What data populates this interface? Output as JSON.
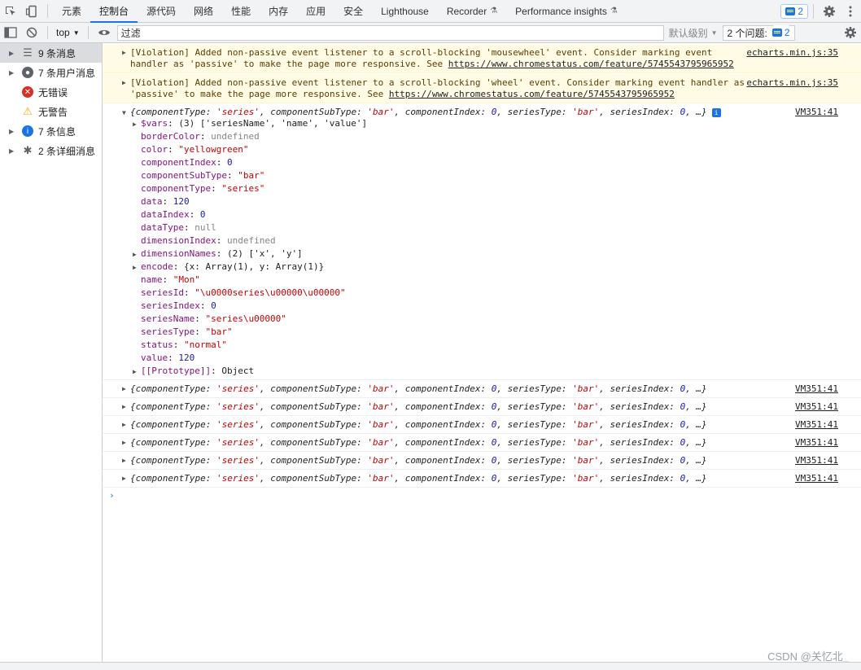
{
  "tabs": [
    {
      "label": "元素"
    },
    {
      "label": "控制台",
      "active": true
    },
    {
      "label": "源代码"
    },
    {
      "label": "网络"
    },
    {
      "label": "性能"
    },
    {
      "label": "内存"
    },
    {
      "label": "应用"
    },
    {
      "label": "安全"
    },
    {
      "label": "Lighthouse"
    },
    {
      "label": "Recorder"
    },
    {
      "label": "Performance insights"
    }
  ],
  "issue_badge_count": "2",
  "toolbar": {
    "context": "top",
    "filter_placeholder": "过滤",
    "levels_label": "默认级别",
    "issues_label": "2 个问题:",
    "issues_count": "2"
  },
  "sidebar": [
    {
      "label": "9 条消息",
      "icon": "list-icon",
      "selected": true
    },
    {
      "label": "7 条用户消息",
      "icon": "user-icon"
    },
    {
      "label": "无错误",
      "icon": "error-icon"
    },
    {
      "label": "无警告",
      "icon": "warning-icon"
    },
    {
      "label": "7 条信息",
      "icon": "info-icon"
    },
    {
      "label": "2 条详细消息",
      "icon": "bug-icon"
    }
  ],
  "warnings": [
    {
      "text_pre": "[Violation] Added non-passive event listener to a scroll-blocking 'mousewheel' event. Consider marking event\nhandler as 'passive' to make the page more responsive. See ",
      "link": "https://www.chromestatus.com/feature/5745543795965952",
      "src": "echarts.min.js:35"
    },
    {
      "text_pre": "[Violation] Added non-passive event listener to a scroll-blocking 'wheel' event. Consider marking event handler as\n'passive' to make the page more responsive. See ",
      "link": "https://www.chromestatus.com/feature/5745543795965952",
      "src": "echarts.min.js:35"
    }
  ],
  "log_src": "VM351:41",
  "summary": {
    "p1": "{componentType: ",
    "v1": "'series'",
    "p2": ", componentSubType: ",
    "v2": "'bar'",
    "p3": ", componentIndex: ",
    "v3": "0",
    "p4": ", seriesType: ",
    "v4": "'bar'",
    "p5": ", seriesIndex: ",
    "v5": "0",
    "p6": ", …}"
  },
  "expanded_props": [
    {
      "key": "$vars",
      "val": "(3) ['seriesName', 'name', 'value']",
      "type": "arr",
      "collapsible": true
    },
    {
      "key": "borderColor",
      "val": "undefined",
      "type": "u"
    },
    {
      "key": "color",
      "val": "\"yellowgreen\"",
      "type": "s"
    },
    {
      "key": "componentIndex",
      "val": "0",
      "type": "n"
    },
    {
      "key": "componentSubType",
      "val": "\"bar\"",
      "type": "s"
    },
    {
      "key": "componentType",
      "val": "\"series\"",
      "type": "s"
    },
    {
      "key": "data",
      "val": "120",
      "type": "n"
    },
    {
      "key": "dataIndex",
      "val": "0",
      "type": "n"
    },
    {
      "key": "dataType",
      "val": "null",
      "type": "u"
    },
    {
      "key": "dimensionIndex",
      "val": "undefined",
      "type": "u"
    },
    {
      "key": "dimensionNames",
      "val": "(2) ['x', 'y']",
      "type": "arr",
      "collapsible": true
    },
    {
      "key": "encode",
      "val": "{x: Array(1), y: Array(1)}",
      "type": "arr",
      "collapsible": true
    },
    {
      "key": "name",
      "val": "\"Mon\"",
      "type": "s"
    },
    {
      "key": "seriesId",
      "val": "\"\\u0000series\\u00000\\u00000\"",
      "type": "s"
    },
    {
      "key": "seriesIndex",
      "val": "0",
      "type": "n"
    },
    {
      "key": "seriesName",
      "val": "\"series\\u00000\"",
      "type": "s"
    },
    {
      "key": "seriesType",
      "val": "\"bar\"",
      "type": "s"
    },
    {
      "key": "status",
      "val": "\"normal\"",
      "type": "s"
    },
    {
      "key": "value",
      "val": "120",
      "type": "n"
    },
    {
      "key": "[[Prototype]]",
      "val": "Object",
      "type": "arr",
      "collapsible": true
    }
  ],
  "collapsed_count": 6,
  "watermark": "CSDN @关忆北_"
}
